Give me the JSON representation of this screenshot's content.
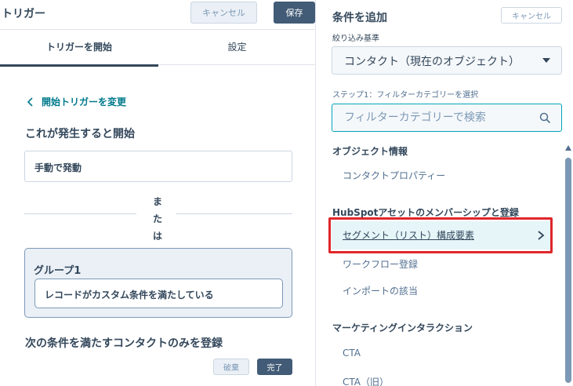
{
  "left_panel": {
    "title": "トリガー",
    "cancel_label": "キャンセル",
    "save_label": "保存",
    "tabs": [
      {
        "label": "トリガーを開始",
        "active": true
      },
      {
        "label": "設定",
        "active": false
      }
    ],
    "back_link": "開始トリガーを変更",
    "start_heading": "これが発生すると開始",
    "manual_trigger": "手動で発動",
    "or_text": [
      "ま",
      "た",
      "は"
    ],
    "group": {
      "title": "グループ1",
      "condition": "レコードがカスタム条件を満たしている"
    },
    "condition_heading": "次の条件を満たすコンタクトのみを登録",
    "discard_label": "破棄",
    "done_label": "完了"
  },
  "right_panel": {
    "title": "条件を追加",
    "cancel_label": "キャンセル",
    "filter_label": "絞り込み基準",
    "filter_value": "コンタクト（現在のオブジェクト）",
    "step_label": "ステップ1：フィルターカテゴリーを選択",
    "search_placeholder": "フィルターカテゴリーで検索",
    "categories": [
      {
        "header": "オブジェクト情報",
        "items": [
          "コンタクトプロパティー"
        ]
      },
      {
        "header": "HubSpotアセットのメンバーシップと登録",
        "items": [
          "セグメント（リスト）構成要素",
          "ワークフロー登録",
          "インポートの該当"
        ]
      },
      {
        "header": "マーケティングインタラクション",
        "items": [
          "CTA",
          "CTA（旧）"
        ]
      }
    ]
  },
  "colors": {
    "accent_dark": "#425b76",
    "link_teal": "#007a8c",
    "highlight_red": "#e0262b",
    "active_row_bg": "#e5f5f8",
    "group_bg": "#eaf0f6"
  },
  "icons": [
    "chevron-left-icon",
    "caret-down-icon",
    "search-icon",
    "chevron-right-icon",
    "scroll-up-icon"
  ]
}
